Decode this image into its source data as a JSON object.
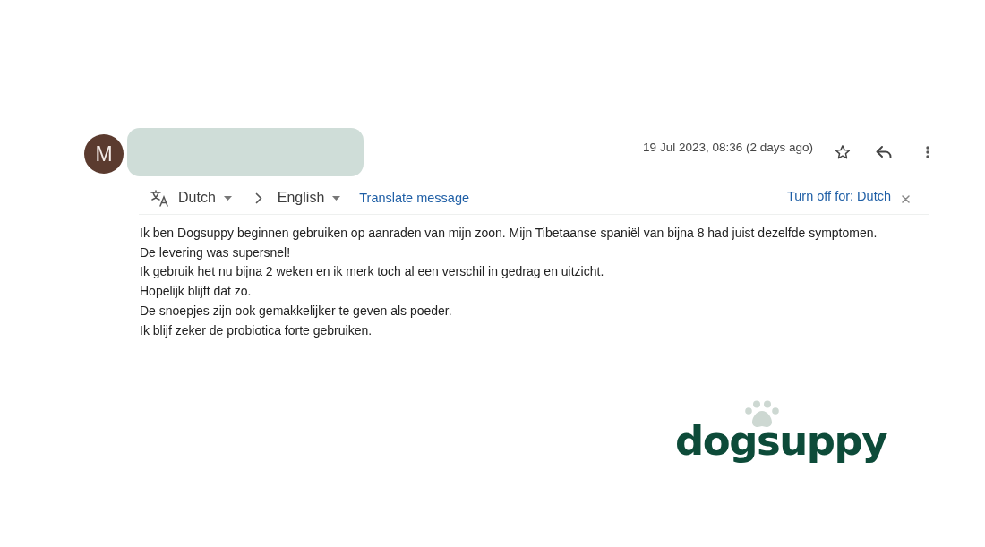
{
  "sender": {
    "initial": "M"
  },
  "message_header": {
    "date": "19 Jul 2023, 08:36 (2 days ago)",
    "starred": false
  },
  "translation_bar": {
    "source_language": "Dutch",
    "target_language": "English",
    "translate_link": "Translate message",
    "turn_off_link": "Turn off for: Dutch"
  },
  "body": {
    "lines": [
      "Ik ben Dogsuppy beginnen gebruiken op aanraden van mijn zoon. Mijn Tibetaanse spaniël van bijna 8 had juist dezelfde symptomen.",
      "De levering was supersnel!",
      "Ik gebruik het nu bijna 2 weken en ik merk toch al een verschil in gedrag en uitzicht.",
      "Hopelijk blijft dat zo.",
      "De snoepjes zijn ook gemakkelijker te geven als poeder.",
      "Ik blijf zeker de probiotica forte gebruiken."
    ]
  },
  "logo": {
    "text": "dogsuppy"
  }
}
